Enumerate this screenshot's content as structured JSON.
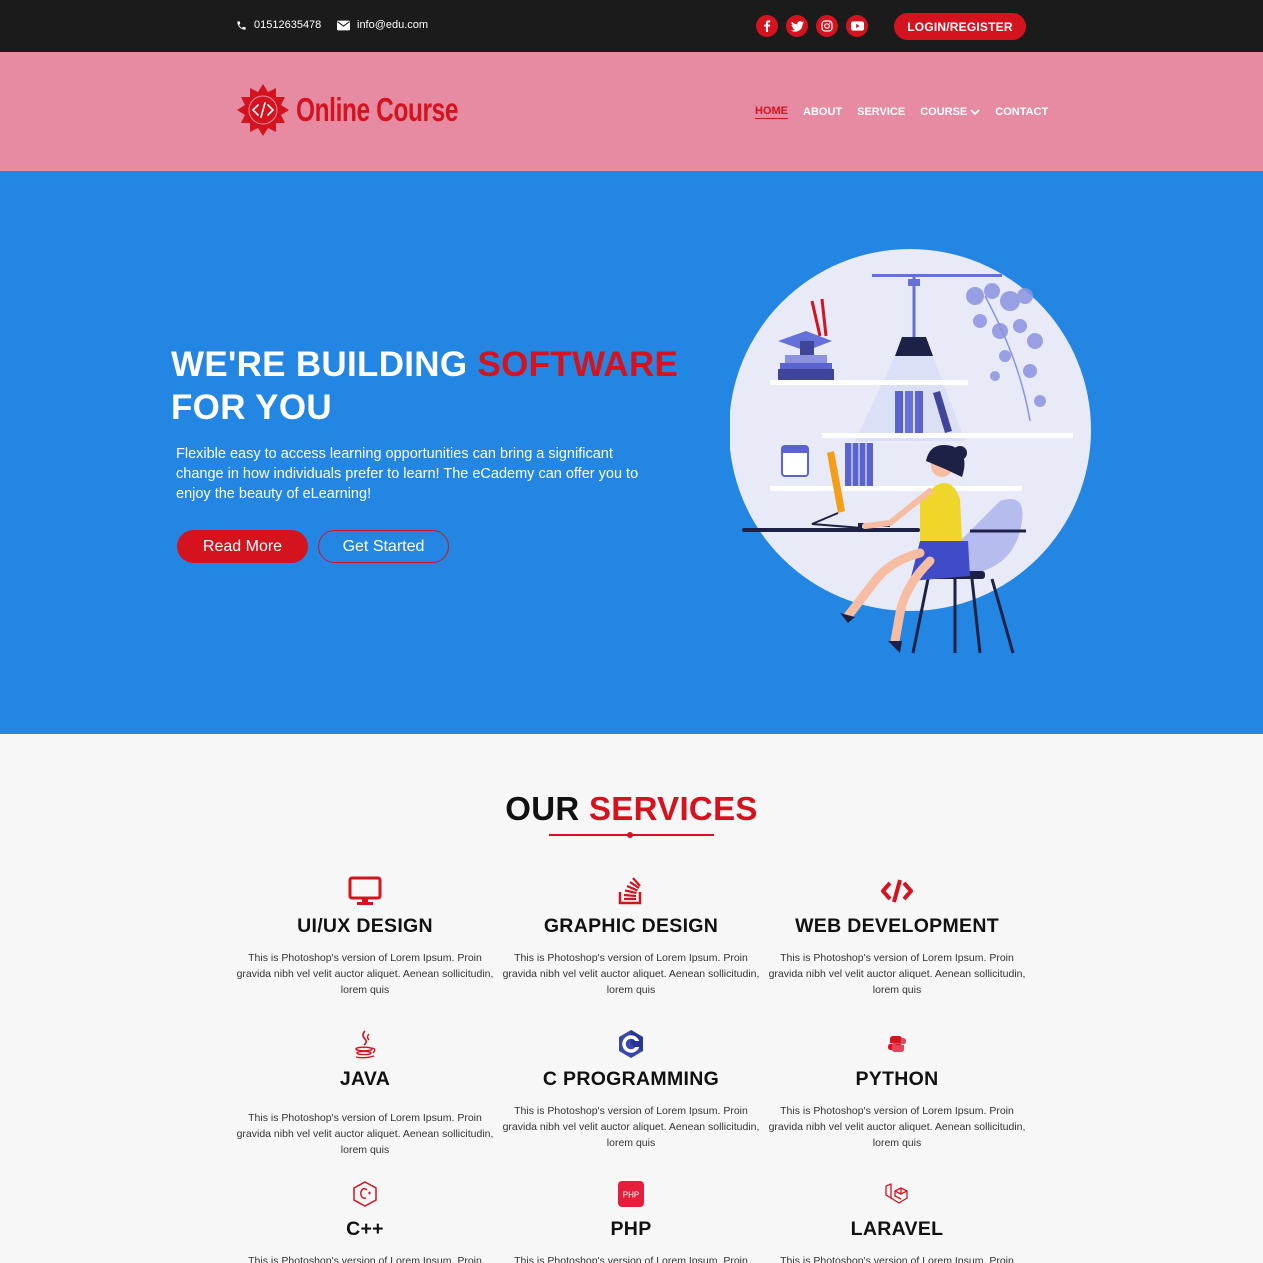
{
  "topbar": {
    "phone": "01512635478",
    "email": "info@edu.com",
    "socials": [
      "facebook-icon",
      "twitter-icon",
      "instagram-icon",
      "youtube-icon"
    ],
    "login_label": "LOGIN/REGISTER"
  },
  "header": {
    "logo_text": "Online Course",
    "nav": [
      "HOME",
      "ABOUT",
      "SERVICE",
      "COURSE",
      "CONTACT"
    ],
    "active_nav": "HOME"
  },
  "hero": {
    "title_part1": "WE'RE BUILDING ",
    "title_accent": "SOFTWARE",
    "title_part2": "FOR YOU",
    "description": "Flexible easy to access learning opportunities can bring a significant change in how individuals prefer to learn! The eCademy can offer you to enjoy the beauty of eLearning!",
    "read_more": "Read More",
    "get_started": "Get Started"
  },
  "services": {
    "title_part1": "OUR ",
    "title_accent": "SERVICES",
    "items": [
      {
        "name": "UI/UX DESIGN",
        "icon": "monitor-icon",
        "desc": "This is Photoshop's version  of Lorem Ipsum. Proin gravida nibh vel velit auctor aliquet. Aenean sollicitudin, lorem quis"
      },
      {
        "name": "GRAPHIC DESIGN",
        "icon": "stack-icon",
        "desc": "This is Photoshop's version  of Lorem Ipsum. Proin gravida nibh vel velit auctor aliquet. Aenean sollicitudin, lorem quis"
      },
      {
        "name": "WEB DEVELOPMENT",
        "icon": "code-icon",
        "desc": "This is Photoshop's version  of Lorem Ipsum. Proin gravida nibh vel velit auctor aliquet. Aenean sollicitudin, lorem quis"
      },
      {
        "name": "JAVA",
        "icon": "java-icon",
        "desc": "This is Photoshop's version  of Lorem Ipsum. Proin gravida nibh vel velit auctor aliquet. Aenean sollicitudin, lorem quis"
      },
      {
        "name": "C PROGRAMMING",
        "icon": "c-language-icon",
        "desc": "This is Photoshop's version  of Lorem Ipsum. Proin gravida nibh vel velit auctor aliquet. Aenean sollicitudin, lorem quis"
      },
      {
        "name": "PYTHON",
        "icon": "python-icon",
        "desc": "This is Photoshop's version  of Lorem Ipsum. Proin gravida nibh vel velit auctor aliquet. Aenean sollicitudin, lorem quis"
      },
      {
        "name": "C++",
        "icon": "cpp-icon",
        "desc": "This is Photoshop's version  of Lorem Ipsum. Proin gravida nibh vel velit auctor aliquet. Aenean sollicitudin, lorem quis"
      },
      {
        "name": "PHP",
        "icon": "php-icon",
        "desc": "This is Photoshop's version  of Lorem Ipsum. Proin gravida nibh vel velit auctor aliquet. Aenean sollicitudin, lorem quis"
      },
      {
        "name": "LARAVEL",
        "icon": "laravel-icon",
        "desc": "This is Photoshop's version  of Lorem Ipsum. Proin gravida nibh vel velit auctor aliquet. Aenean sollicitudin, lorem quis"
      }
    ]
  },
  "colors": {
    "accent": "#d4131f",
    "topbar": "#1b1b1b",
    "header": "#e78ba3",
    "hero": "#2386e3",
    "page": "#f7f7f8"
  }
}
